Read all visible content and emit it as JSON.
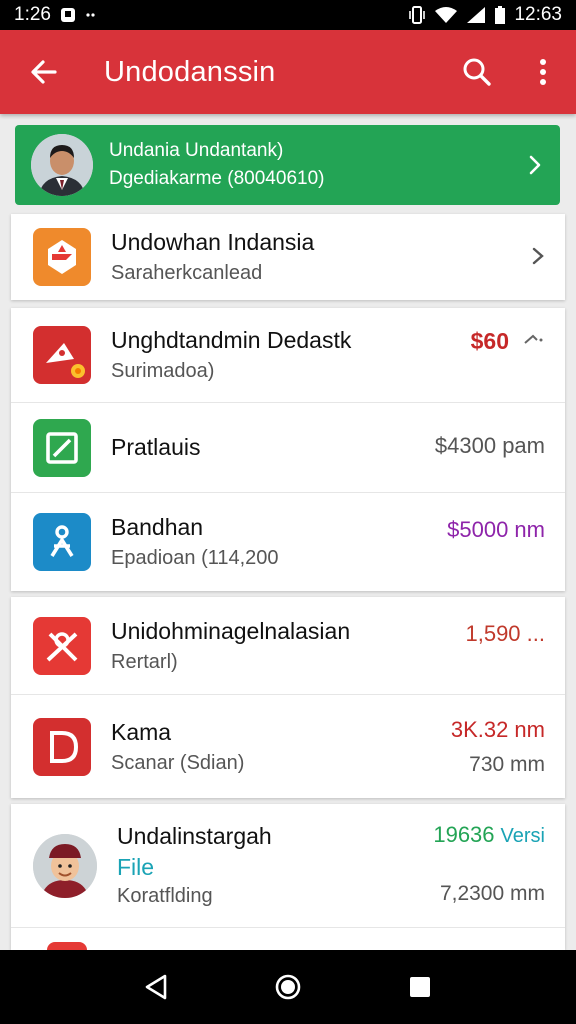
{
  "status_bar": {
    "time": "1:26",
    "right_time": "12:63",
    "icons": [
      "notification-icon",
      "more-dots-icon",
      "vibrate-icon",
      "wifi-icon",
      "signal-icon",
      "battery-icon"
    ]
  },
  "app_bar": {
    "title": "Undodanssin",
    "back_icon": "arrow-left-icon",
    "search_icon": "search-icon",
    "menu_icon": "more-vert-icon",
    "color": "#d8333a"
  },
  "banner": {
    "line1": "Undania Undantank)",
    "line2": "Dgediakarme (80040610)",
    "color": "#23a455"
  },
  "card1": {
    "title": "Undowhan Indansia",
    "subtitle": "Saraherkcanlead"
  },
  "list": [
    {
      "title": "Unghdtandmin Dedastk",
      "subtitle": "Surimadoa)",
      "price": "$60",
      "price_color": "#c62828"
    },
    {
      "title": "Pratlauis",
      "subtitle": "",
      "price": "$4300 pam",
      "price_color": "#555555"
    },
    {
      "title": "Bandhan",
      "subtitle": "Epadioan (114,200",
      "price": "$5000 nm",
      "price_color": "#8e24aa"
    }
  ],
  "list2": [
    {
      "title": "Unidohminagelnalasian",
      "subtitle": "Rertarl)",
      "price": "1,590 ...",
      "price_color": "#c0392b"
    },
    {
      "title": "Kama",
      "subtitle": "Scanar (Sdian)",
      "price": "3K.32 nm",
      "price_color": "#c62828",
      "sub_right": "730 mm"
    }
  ],
  "list3": [
    {
      "title": "Undalinstargah",
      "title2": "File",
      "subtitle": "Koratflding",
      "price": "19636",
      "price_suffix": "Versi",
      "price_color": "#23a455",
      "sub_right": "7,2300 mm"
    }
  ],
  "nav": {
    "back": "nav-back-icon",
    "home": "nav-home-icon",
    "recents": "nav-recents-icon"
  }
}
